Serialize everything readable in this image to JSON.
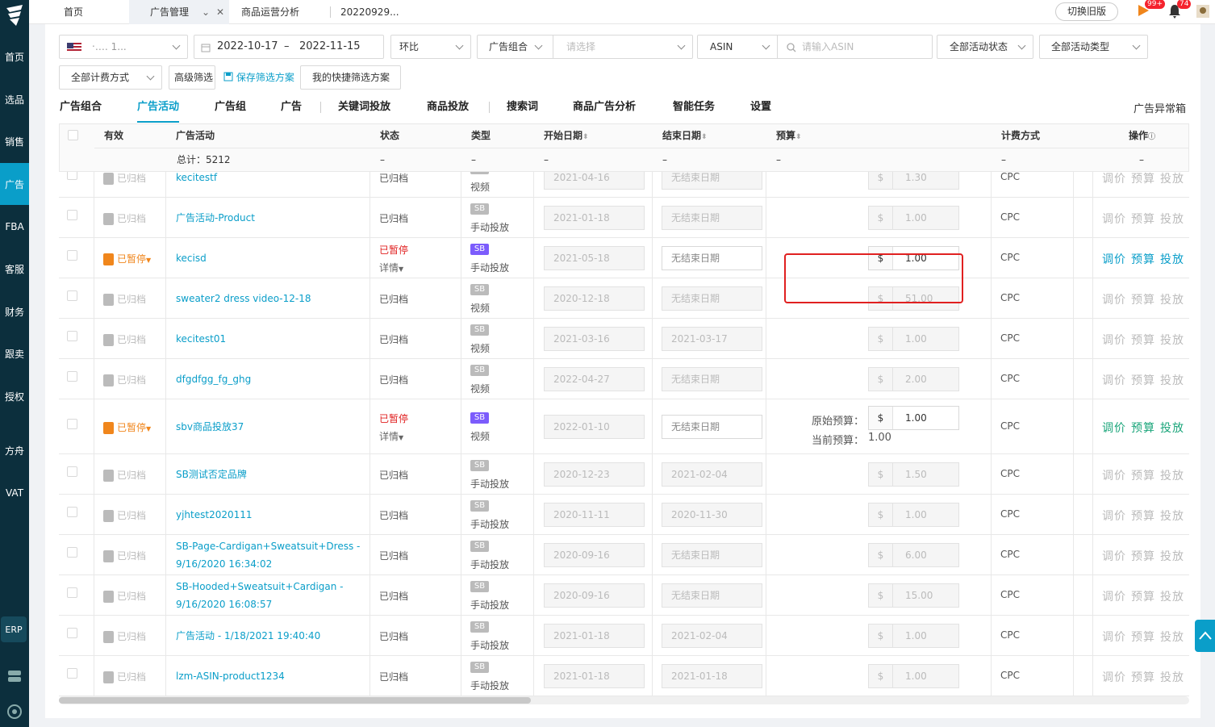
{
  "sidebar": {
    "items": [
      "首页",
      "选品",
      "销售",
      "广告",
      "FBA",
      "客服",
      "财务",
      "跟卖",
      "授权",
      "方舟",
      "VAT"
    ],
    "active_index": 3,
    "erp_label": "ERP"
  },
  "topbar": {
    "tabs": [
      "首页",
      "广告管理",
      "商品运营分析",
      "20220929..."
    ],
    "active_tab": "广告管理",
    "switch_label": "切换旧版",
    "flag_badge": "99+",
    "bell_badge": "74"
  },
  "filters": {
    "store_label": "‧‥‥ 1...",
    "date_start": "2022-10-17",
    "date_sep": "–",
    "date_end": "2022-11-15",
    "compare": "环比",
    "group_label": "广告组合",
    "group_placeholder": "请选择",
    "asin_label": "ASIN",
    "asin_placeholder": "请输入ASIN",
    "status_select": "全部活动状态",
    "type_select": "全部活动类型",
    "billing_select": "全部计费方式",
    "advanced_btn": "高级筛选",
    "save_btn": "保存筛选方案",
    "quick_btn": "我的快捷筛选方案"
  },
  "subnav": {
    "items": [
      "广告组合",
      "广告活动",
      "广告组",
      "广告",
      "关键词投放",
      "商品投放",
      "搜索词",
      "商品广告分析",
      "智能任务",
      "设置"
    ],
    "active": "广告活动",
    "right_label": "广告异常箱"
  },
  "table": {
    "headers": {
      "valid": "有效",
      "campaign": "广告活动",
      "status": "状态",
      "type": "类型",
      "start": "开始日期",
      "end": "结束日期",
      "budget": "预算",
      "billing": "计费方式",
      "ops": "操作"
    },
    "total_label": "总计：5212",
    "dash": "–",
    "ops_labels": [
      "调价",
      "预算",
      "投放"
    ],
    "currency": "$",
    "rows": [
      {
        "state": "已归档",
        "name": "kecitestf",
        "status": "已归档",
        "tag": "",
        "type": "视频",
        "start": "2021-04-16",
        "end": "无结束日期",
        "budget": "1.30",
        "billing": "CPC"
      },
      {
        "state": "已归档",
        "name": "广告活动-Product",
        "status": "已归档",
        "tag": "SB",
        "type": "手动投放",
        "start": "2021-01-18",
        "end": "无结束日期",
        "budget": "1.00",
        "billing": "CPC"
      },
      {
        "state": "已暂停",
        "name": "kecisd",
        "status": "已暂停",
        "detail": "详情",
        "tag": "SB",
        "type": "手动投放",
        "start": "2021-05-18",
        "end": "无结束日期",
        "budget": "1.00",
        "billing": "CPC"
      },
      {
        "state": "已归档",
        "name": "sweater2 dress video-12-18",
        "status": "已归档",
        "tag": "SB",
        "type": "视频",
        "start": "2020-12-18",
        "end": "无结束日期",
        "budget": "51.00",
        "billing": "CPC"
      },
      {
        "state": "已归档",
        "name": "kecitest01",
        "status": "已归档",
        "tag": "SB",
        "type": "视频",
        "start": "2021-03-16",
        "end": "2021-03-17",
        "budget": "1.00",
        "billing": "CPC"
      },
      {
        "state": "已归档",
        "name": "dfgdfgg_fg_ghg",
        "status": "已归档",
        "tag": "SB",
        "type": "视频",
        "start": "2022-04-27",
        "end": "无结束日期",
        "budget": "2.00",
        "billing": "CPC"
      },
      {
        "state": "已暂停",
        "name": "sbv商品投放37",
        "status": "已暂停",
        "detail": "详情",
        "tag": "SB",
        "type": "视频",
        "start": "2022-01-10",
        "end": "无结束日期",
        "budget": "1.00",
        "orig_label": "原始预算：",
        "current_label": "当前预算：",
        "current_value": "1.00",
        "billing": "CPC"
      },
      {
        "state": "已归档",
        "name": "SB测试否定品牌",
        "status": "已归档",
        "tag": "SB",
        "type": "手动投放",
        "start": "2020-12-23",
        "end": "2021-02-04",
        "budget": "1.50",
        "billing": "CPC"
      },
      {
        "state": "已归档",
        "name": "yjhtest2020111",
        "status": "已归档",
        "tag": "SB",
        "type": "手动投放",
        "start": "2020-11-11",
        "end": "2020-11-30",
        "budget": "1.00",
        "billing": "CPC"
      },
      {
        "state": "已归档",
        "name": "SB-Page-Cardigan+Sweatsuit+Dress - 9/16/2020 16:34:02",
        "status": "已归档",
        "tag": "SB",
        "type": "手动投放",
        "start": "2020-09-16",
        "end": "无结束日期",
        "budget": "6.00",
        "billing": "CPC"
      },
      {
        "state": "已归档",
        "name": "SB-Hooded+Sweatsuit+Cardigan - 9/16/2020 16:08:57",
        "status": "已归档",
        "tag": "SB",
        "type": "手动投放",
        "start": "2020-09-16",
        "end": "无结束日期",
        "budget": "15.00",
        "billing": "CPC"
      },
      {
        "state": "已归档",
        "name": "广告活动 - 1/18/2021 19:40:40",
        "status": "已归档",
        "tag": "SB",
        "type": "手动投放",
        "start": "2021-01-18",
        "end": "2021-02-04",
        "budget": "1.00",
        "billing": "CPC"
      },
      {
        "state": "已归档",
        "name": "lzm-ASIN-product1234",
        "status": "已归档",
        "tag": "SB",
        "type": "手动投放",
        "start": "2021-01-18",
        "end": "2021-01-18",
        "budget": "1.00",
        "billing": "CPC"
      }
    ]
  }
}
